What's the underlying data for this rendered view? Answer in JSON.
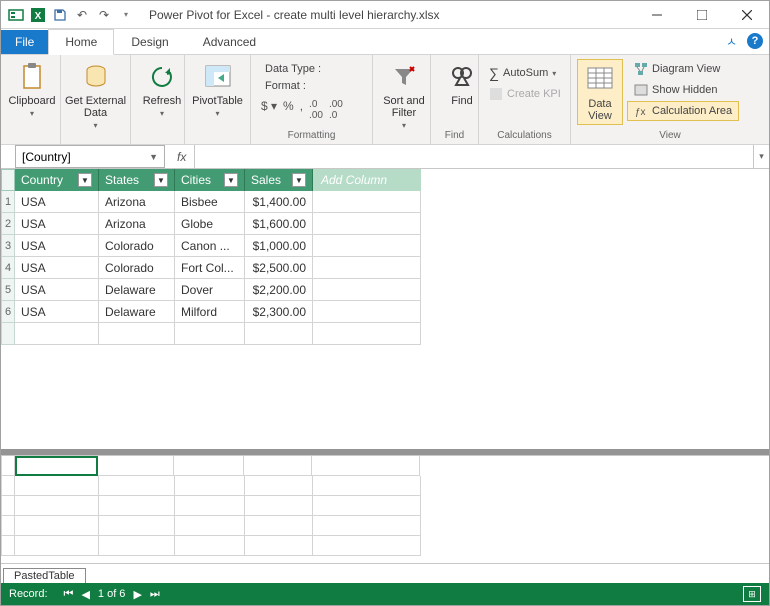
{
  "title": "Power Pivot for Excel - create multi level hierarchy.xlsx",
  "tabs": {
    "file": "File",
    "home": "Home",
    "design": "Design",
    "advanced": "Advanced"
  },
  "ribbon": {
    "clipboard": {
      "label": "Clipboard"
    },
    "getdata": {
      "label": "Get External\nData"
    },
    "refresh": {
      "label": "Refresh"
    },
    "pivot": {
      "label": "PivotTable"
    },
    "formatting": {
      "group": "Formatting",
      "dtype": "Data Type :",
      "format": "Format :"
    },
    "sortfilter": {
      "label": "Sort and\nFilter"
    },
    "find": {
      "label": "Find",
      "group": "Find"
    },
    "calc": {
      "group": "Calculations",
      "autosum": "AutoSum",
      "kpi": "Create KPI"
    },
    "view": {
      "group": "View",
      "dataview": "Data\nView",
      "diagram": "Diagram View",
      "hidden": "Show Hidden",
      "calcarea": "Calculation Area"
    }
  },
  "namebox": "[Country]",
  "fx": "fx",
  "columns": [
    "Country",
    "States",
    "Cities",
    "Sales"
  ],
  "addcol": "Add Column",
  "rows": [
    {
      "n": "1",
      "c": [
        "USA",
        "Arizona",
        "Bisbee",
        "$1,400.00"
      ]
    },
    {
      "n": "2",
      "c": [
        "USA",
        "Arizona",
        "Globe",
        "$1,600.00"
      ]
    },
    {
      "n": "3",
      "c": [
        "USA",
        "Colorado",
        "Canon ...",
        "$1,000.00"
      ]
    },
    {
      "n": "4",
      "c": [
        "USA",
        "Colorado",
        "Fort Col...",
        "$2,500.00"
      ]
    },
    {
      "n": "5",
      "c": [
        "USA",
        "Delaware",
        "Dover",
        "$2,200.00"
      ]
    },
    {
      "n": "6",
      "c": [
        "USA",
        "Delaware",
        "Milford",
        "$2,300.00"
      ]
    }
  ],
  "sheet": "PastedTable",
  "status": {
    "record": "Record:",
    "pos": "1 of 6"
  }
}
